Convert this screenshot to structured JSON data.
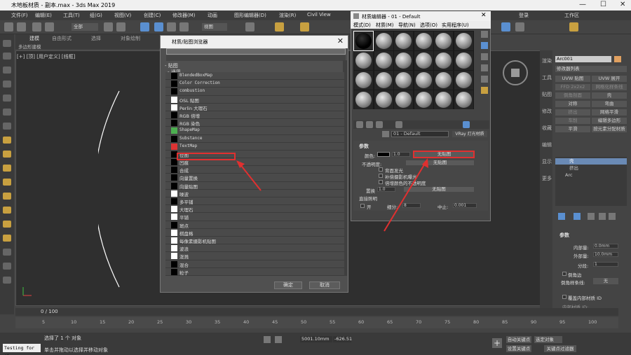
{
  "titlebar": {
    "title": "木地板材质 - 副本.max - 3ds Max 2019",
    "minimize": "—",
    "maximize": "☐",
    "close": "✕"
  },
  "menubar": {
    "items": [
      "文件(F)",
      "编辑(E)",
      "工具(T)",
      "组(G)",
      "视图(V)",
      "创建(C)",
      "修改器(M)",
      "动画",
      "图形编辑器(D)",
      "渲染(R)",
      "Civil View"
    ],
    "login": "登录",
    "workspace": "工作区"
  },
  "toolbar": {
    "filter": "全部",
    "view": "视图"
  },
  "ribbon": {
    "tabs": [
      "建模",
      "自由形式",
      "选择",
      "对象绘制"
    ],
    "sub": "多边形建模"
  },
  "viewport": {
    "label": "[+] [顶] [用户定义] [线框]"
  },
  "mat_browser": {
    "title": "材质/贴图浏览器",
    "section_maps": "- 贴图",
    "section_general": "- 通用",
    "items": [
      {
        "label": "BlendedBoxMap",
        "mono": true
      },
      {
        "label": "Color Correction",
        "mono": true
      },
      {
        "label": "combustion",
        "mono": true
      },
      {
        "label": "OSL 贴图",
        "mono": false
      },
      {
        "label": "Perlin 大理石",
        "mono": false
      },
      {
        "label": "RGB 倍增",
        "mono": false
      },
      {
        "label": "RGB 染色",
        "mono": false
      },
      {
        "label": "ShapeMap",
        "mono": true
      },
      {
        "label": "Substance",
        "mono": true
      },
      {
        "label": "TextMap",
        "mono": true
      },
      {
        "label": "位图",
        "mono": false
      },
      {
        "label": "凹痕",
        "mono": false
      },
      {
        "label": "合成",
        "mono": false
      },
      {
        "label": "向量置换",
        "mono": false
      },
      {
        "label": "向量贴图",
        "mono": false
      },
      {
        "label": "噪波",
        "mono": false
      },
      {
        "label": "多平铺",
        "mono": false
      },
      {
        "label": "大理石",
        "mono": false
      },
      {
        "label": "平铺",
        "mono": false
      },
      {
        "label": "斑点",
        "mono": false
      },
      {
        "label": "棋盘格",
        "mono": false
      },
      {
        "label": "每像素摄影机贴图",
        "mono": false
      },
      {
        "label": "波浪",
        "mono": false
      },
      {
        "label": "泼溅",
        "mono": false
      },
      {
        "label": "混合",
        "mono": false
      },
      {
        "label": "粒子",
        "mono": false
      }
    ],
    "ok": "确定",
    "cancel": "取消"
  },
  "mat_editor": {
    "title": "材质编辑器 - 01 - Default",
    "menu": [
      "模式(D)",
      "材质(M)",
      "导航(N)",
      "选项(O)",
      "实用程序(U)"
    ],
    "material_name": "01 - Default",
    "material_type": "VRay 灯光材质",
    "params_header": "参数",
    "color_label": "颜色:",
    "color_value": "1.0",
    "no_map": "无贴图",
    "opacity_label": "不透明度:",
    "backface": "背面发光",
    "comp_exposure": "补偿摄影机曝光",
    "multiply_color": "倍增颜色的不透明度",
    "displace_label": "置换",
    "displace_value": "1.0",
    "direct_light": "直接照明",
    "on_label": "开",
    "subdivs_label": "细分:",
    "subdivs_value": "8",
    "cutoff_label": "中止:",
    "cutoff_value": "0.001"
  },
  "right_panel": {
    "object_name": "Arc001",
    "modifier_list": "修改器列表",
    "buttons": [
      "UVW 贴图",
      "UVW 展开",
      "FFD 2x2x2",
      "网格化样条线",
      "倒角剖面",
      "壳",
      "对称",
      "弯曲",
      "挤出",
      "网格平滑",
      "车削",
      "编辑多边形",
      "平滑",
      "按元素分配材质"
    ],
    "stack": [
      "壳",
      "挤出",
      "Arc"
    ],
    "params_title": "参数",
    "inner_label": "内部量:",
    "inner_value": "0.0mm",
    "outer_label": "外部量:",
    "outer_value": "10.0mm",
    "segments_label": "分段:",
    "segments_value": "1",
    "bevel_edge": "倒角边",
    "bevel_spline": "倒角样条线:",
    "none": "无",
    "override_inner": "覆盖内部材质 ID",
    "inner_mat": "内部材质 ID:"
  },
  "side_tabs": [
    "渲染",
    "工具",
    "贴图",
    "修改",
    "收藏",
    "编辑",
    "显示",
    "更多"
  ],
  "timeline": {
    "frame": "0 / 100",
    "ticks": [
      "5",
      "10",
      "15",
      "20",
      "25",
      "30",
      "35",
      "40",
      "45",
      "50",
      "55",
      "60",
      "65",
      "70",
      "75",
      "80",
      "85",
      "90",
      "95",
      "100"
    ]
  },
  "status": {
    "selected": "选择了 1 个 对象",
    "hint": "单击并拖动以选择并移动对象",
    "script": "Testing for AD:",
    "x_coord": "5001.10mm",
    "y_coord": "-626.51",
    "autokey": "自动关键点",
    "setkey": "设置关键点",
    "selected_obj": "选定对象",
    "keyfilter": "关键点过滤器"
  },
  "colors": {
    "highlight_red": "#e03030",
    "selection_blue": "#6a8ab5"
  }
}
